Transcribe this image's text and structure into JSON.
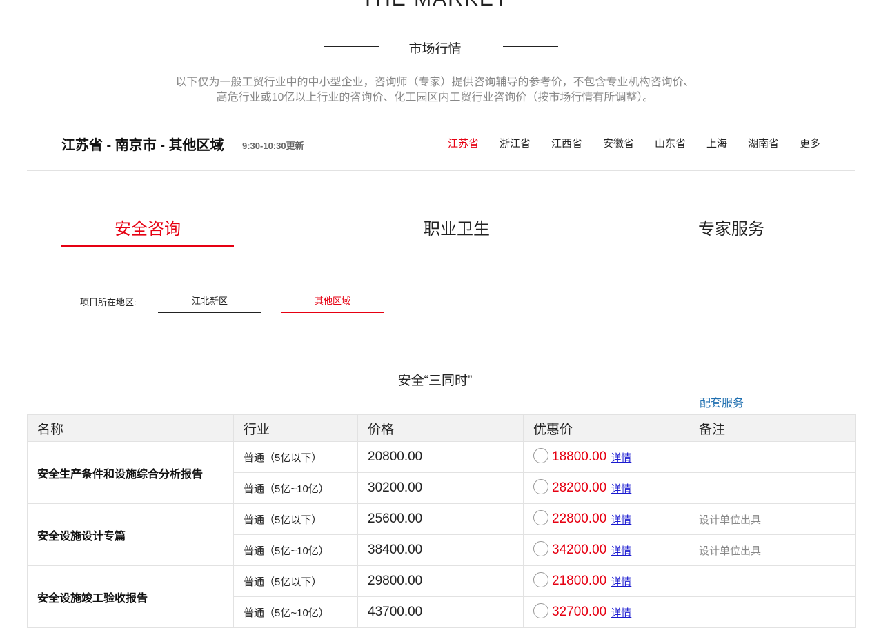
{
  "header": {
    "en_title": "THE MARKET",
    "section_title": "市场行情",
    "description_line1": "以下仅为一般工贸行业中的中小型企业，咨询师（专家）提供咨询辅导的参考价，不包含专业机构咨询价、",
    "description_line2": "高危行业或10亿以上行业的咨询价、化工园区内工贸行业咨询价（按市场行情有所调整）。"
  },
  "location": {
    "text": "江苏省 - 南京市 - 其他区域",
    "update_time": "9:30-10:30更新"
  },
  "provinces": [
    "江苏省",
    "浙江省",
    "江西省",
    "安徽省",
    "山东省",
    "上海",
    "湖南省",
    "更多"
  ],
  "tabs": [
    "安全咨询",
    "职业卫生",
    "专家服务"
  ],
  "region": {
    "label": "项目所在地区:",
    "options": [
      "江北新区",
      "其他区域"
    ]
  },
  "section2": {
    "title": "安全“三同时”",
    "service_link": "配套服务"
  },
  "table": {
    "headers": [
      "名称",
      "行业",
      "价格",
      "优惠价",
      "备注"
    ],
    "detail_label": "详情",
    "groups": [
      {
        "name": "安全生产条件和设施综合分析报告",
        "rows": [
          {
            "industry": "普通（5亿以下）",
            "price": "20800.00",
            "discount": "18800.00",
            "note": ""
          },
          {
            "industry": "普通（5亿~10亿）",
            "price": "30200.00",
            "discount": "28200.00",
            "note": ""
          }
        ]
      },
      {
        "name": "安全设施设计专篇",
        "rows": [
          {
            "industry": "普通（5亿以下）",
            "price": "25600.00",
            "discount": "22800.00",
            "note": "设计单位出具"
          },
          {
            "industry": "普通（5亿~10亿）",
            "price": "38400.00",
            "discount": "34200.00",
            "note": "设计单位出具"
          }
        ]
      },
      {
        "name": "安全设施竣工验收报告",
        "rows": [
          {
            "industry": "普通（5亿以下）",
            "price": "29800.00",
            "discount": "21800.00",
            "note": ""
          },
          {
            "industry": "普通（5亿~10亿）",
            "price": "43700.00",
            "discount": "32700.00",
            "note": ""
          }
        ]
      }
    ]
  },
  "colors": {
    "accent_red": "#e60012",
    "link_blue": "#1f6fb0",
    "detail_link": "#1a1ad0",
    "muted_gray": "#888888"
  }
}
